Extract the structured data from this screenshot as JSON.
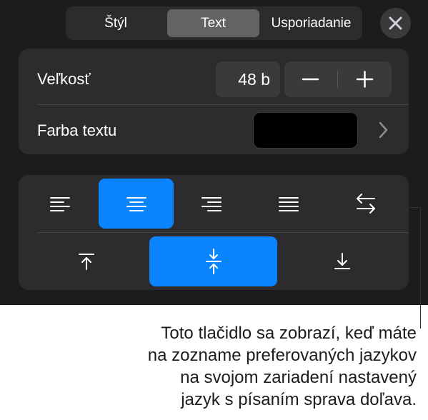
{
  "tabs": [
    {
      "label": "Štýl",
      "active": false
    },
    {
      "label": "Text",
      "active": true
    },
    {
      "label": "Usporiadanie",
      "active": false
    }
  ],
  "size": {
    "label": "Veľkosť",
    "value": "48 b"
  },
  "text_color": {
    "label": "Farba textu",
    "color": "#000000"
  },
  "alignment": {
    "horizontal": [
      "align-left",
      "align-center",
      "align-right",
      "justify",
      "text-direction"
    ],
    "horizontal_selected": "align-center",
    "vertical": [
      "align-top",
      "align-middle",
      "align-bottom"
    ],
    "vertical_selected": "align-middle"
  },
  "colors": {
    "accent": "#0a84ff",
    "panel": "#1c1c1e",
    "card": "#2c2c2e"
  },
  "callout": {
    "text": "Toto tlačidlo sa zobrazí, keď máte\nna zozname preferovaných jazykov\nna svojom zariadení nastavený\njazyk s písaním sprava doľava."
  }
}
